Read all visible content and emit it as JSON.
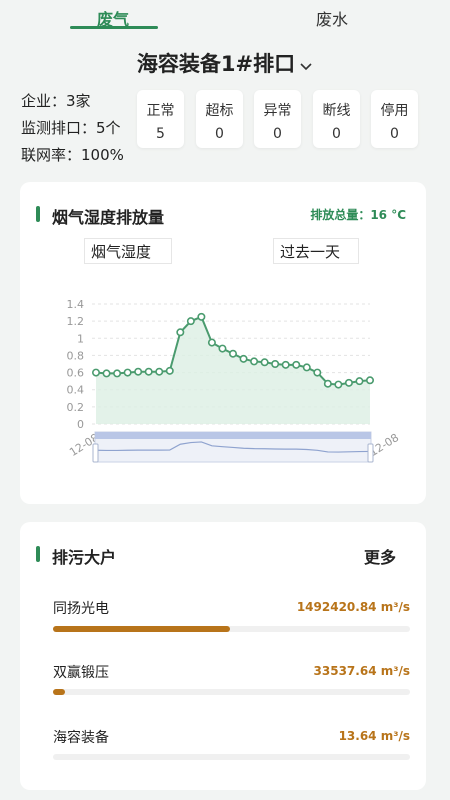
{
  "tabs": [
    {
      "label": "废气",
      "active": true
    },
    {
      "label": "废水",
      "active": false
    }
  ],
  "outlet": {
    "name": "海容装备1#排口"
  },
  "summary": {
    "company": "企业：3家",
    "outlets": "监测排口：5个",
    "online_rate": "联网率：100%"
  },
  "statuses": [
    {
      "label": "正常",
      "value": "5"
    },
    {
      "label": "超标",
      "value": "0"
    },
    {
      "label": "异常",
      "value": "0"
    },
    {
      "label": "断线",
      "value": "0"
    },
    {
      "label": "停用",
      "value": "0"
    }
  ],
  "chart_card": {
    "title": "烟气湿度排放量",
    "total": "排放总量：16 °C",
    "factor_select": "烟气湿度",
    "period_select": "过去一天"
  },
  "chart_data": {
    "type": "line",
    "title": "",
    "xlabel": "",
    "ylabel": "",
    "ylim": [
      0,
      1.4
    ],
    "yticks": [
      "0",
      "0.2",
      "0.4",
      "0.6",
      "0.8",
      "1",
      "1.2",
      "1.4"
    ],
    "xtick_labels": [
      "12-08",
      "12-08",
      "12-08",
      "12-08",
      "12-08",
      "12-08",
      "12-08",
      "12-08",
      "12-08"
    ],
    "x": [
      1,
      2,
      3,
      4,
      5,
      6,
      7,
      8,
      9,
      10,
      11,
      12,
      13,
      14,
      15,
      16,
      17,
      18,
      19,
      20,
      21,
      22,
      23,
      24,
      25,
      26,
      27
    ],
    "values": [
      0.6,
      0.59,
      0.59,
      0.6,
      0.61,
      0.61,
      0.61,
      0.62,
      1.07,
      1.2,
      1.25,
      0.95,
      0.88,
      0.82,
      0.76,
      0.73,
      0.72,
      0.7,
      0.69,
      0.69,
      0.66,
      0.6,
      0.47,
      0.46,
      0.48,
      0.5,
      0.51
    ],
    "grid": true,
    "series_color": "#4a9b6e",
    "area_color": "#dcefe3"
  },
  "list_card": {
    "title": "排污大户",
    "more": "更多",
    "items": [
      {
        "name": "同扬光电",
        "value": "1492420.84 m³/s",
        "fraction": 0.497
      },
      {
        "name": "双赢锻压",
        "value": "33537.64 m³/s",
        "fraction": 0.033
      },
      {
        "name": "海容装备",
        "value": "13.64 m³/s",
        "fraction": 0.0
      }
    ]
  },
  "colors": {
    "accent": "#2e8b57",
    "bar": "#b8741a"
  }
}
